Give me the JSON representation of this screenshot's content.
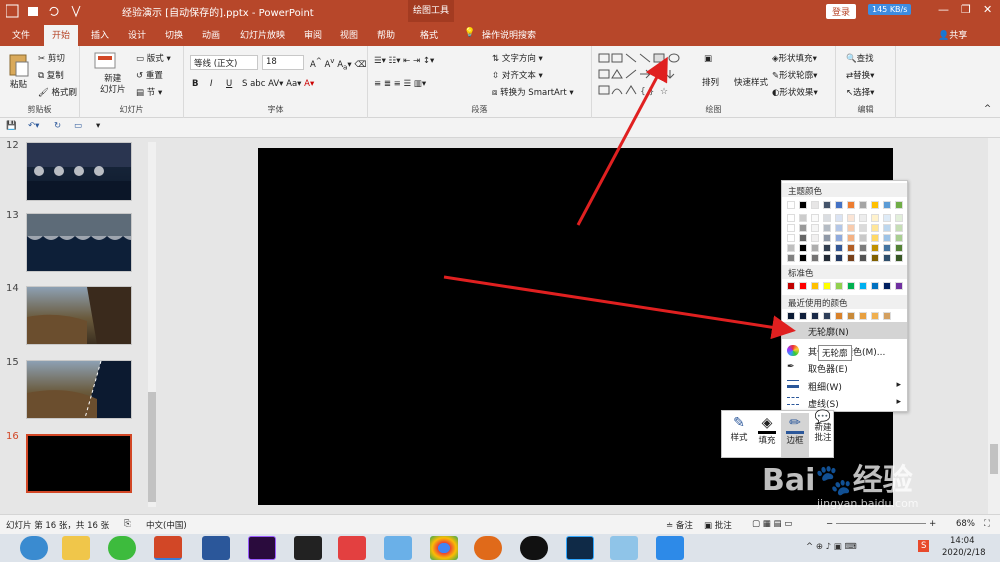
{
  "title_bar": {
    "title": "经验演示 [自动保存的].pptx  -  PowerPoint",
    "context_tab": "绘图工具",
    "login": "登录",
    "net_speed": "145 KB/s"
  },
  "tabs": [
    "文件",
    "开始",
    "插入",
    "设计",
    "切换",
    "动画",
    "幻灯片放映",
    "审阅",
    "视图",
    "帮助",
    "格式"
  ],
  "tell_me": "操作说明搜索",
  "share": "共享",
  "ribbon": {
    "clipboard": {
      "paste": "粘贴",
      "cut": "剪切",
      "copy": "复制",
      "format_painter": "格式刷",
      "label": "剪贴板"
    },
    "slides": {
      "new_slide": "新建\n幻灯片",
      "layout": "版式",
      "reset": "重置",
      "section": "节",
      "label": "幻灯片"
    },
    "font": {
      "font_name": "等线 (正文)",
      "font_size": "18",
      "label": "字体"
    },
    "paragraph": {
      "text_direction": "文字方向",
      "align_text": "对齐文本",
      "smartart": "转换为 SmartArt",
      "label": "段落"
    },
    "drawing": {
      "arrange": "排列",
      "quick_styles": "快速样式",
      "shape_fill": "形状填充",
      "shape_outline": "形状轮廓",
      "shape_effects": "形状效果",
      "label": "绘图"
    },
    "editing": {
      "find": "查找",
      "replace": "替换",
      "select": "选择",
      "label": "编辑"
    }
  },
  "slides": [
    {
      "num": "12"
    },
    {
      "num": "13"
    },
    {
      "num": "14"
    },
    {
      "num": "15"
    },
    {
      "num": "16"
    }
  ],
  "color_panel": {
    "theme_header": "主题颜色",
    "standard_header": "标准色",
    "recent_header": "最近使用的颜色",
    "theme_top": [
      "#ffffff",
      "#000000",
      "#e7e6e6",
      "#44546a",
      "#4472c4",
      "#ed7d31",
      "#a5a5a5",
      "#ffc000",
      "#5b9bd5",
      "#70ad47"
    ],
    "standard": [
      "#c00000",
      "#ff0000",
      "#ffc000",
      "#ffff00",
      "#92d050",
      "#00b050",
      "#00b0f0",
      "#0070c0",
      "#002060",
      "#7030a0"
    ],
    "recent": [
      "#0b1a33",
      "#10203c",
      "#1a2a48",
      "#2e3f5a",
      "#d9822b",
      "#c88a3a",
      "#e8a040",
      "#f0b050",
      "#d4a060"
    ],
    "no_outline": "无轮廓(N)",
    "more_colors": "其他轮廓颜色(M)...",
    "eyedropper": "取色器(E)",
    "weight": "粗细(W)",
    "dashes": "虚线(S)"
  },
  "tooltip": "无轮廓",
  "mini_toolbar": {
    "style": "样式",
    "fill": "填充",
    "outline": "边框",
    "new_comment": "新建\n批注"
  },
  "status_bar": {
    "slide_info": "幻灯片 第 16 张，共 16 张",
    "language": "中文(中国)",
    "notes": "备注",
    "comments": "批注",
    "zoom": "68%"
  },
  "taskbar": {
    "time": "14:04",
    "date": "2020/2/18"
  },
  "watermark": {
    "logo": "Bai🐾经验",
    "url": "jingyan.baidu.com"
  }
}
